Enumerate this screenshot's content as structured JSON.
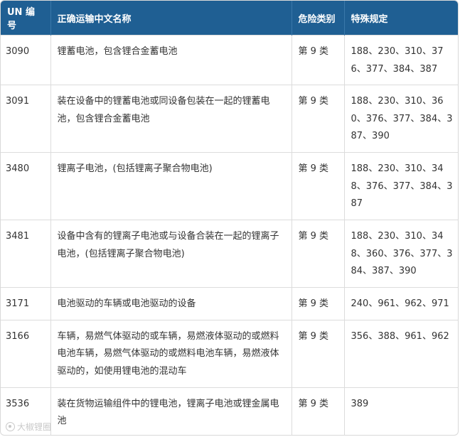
{
  "table": {
    "headers": [
      "UN 编号",
      "正确运输中文名称",
      "危险类别",
      "特殊规定"
    ],
    "rows": [
      {
        "un": "3090",
        "name": "锂蓄电池，包含锂合金蓄电池",
        "class": "第 9 类",
        "special": "188、230、310、376、377、384、387"
      },
      {
        "un": "3091",
        "name": "装在设备中的锂蓄电池或同设备包装在一起的锂蓄电池，包含锂合金蓄电池",
        "class": "第 9 类",
        "special": "188、230、310、360、376、377、384、387、390"
      },
      {
        "un": "3480",
        "name": "锂离子电池，(包括锂离子聚合物电池)",
        "class": "第 9 类",
        "special": "188、230、310、348、376、377、384、387"
      },
      {
        "un": "3481",
        "name": "设备中含有的锂离子电池或与设备合装在一起的锂离子电池，(包括锂离子聚合物电池)",
        "class": "第 9 类",
        "special": "188、230、310、348、360、376、377、384、387、390"
      },
      {
        "un": "3171",
        "name": "电池驱动的车辆或电池驱动的设备",
        "class": "第 9 类",
        "special": "240、961、962、971"
      },
      {
        "un": "3166",
        "name": "车辆，易燃气体驱动的或车辆，易燃液体驱动的或燃料电池车辆，易燃气体驱动的或燃料电池车辆，易燃液体驱动的，如使用锂电池的混动车",
        "class": "第 9 类",
        "special": "356、388、961、962"
      },
      {
        "un": "3536",
        "name": "装在货物运输组件中的锂电池，锂离子电池或锂金属电池",
        "class": "第 9 类",
        "special": "389"
      }
    ]
  },
  "watermark": {
    "text": "大椒锂圈",
    "icon": "watermark-logo-icon"
  }
}
